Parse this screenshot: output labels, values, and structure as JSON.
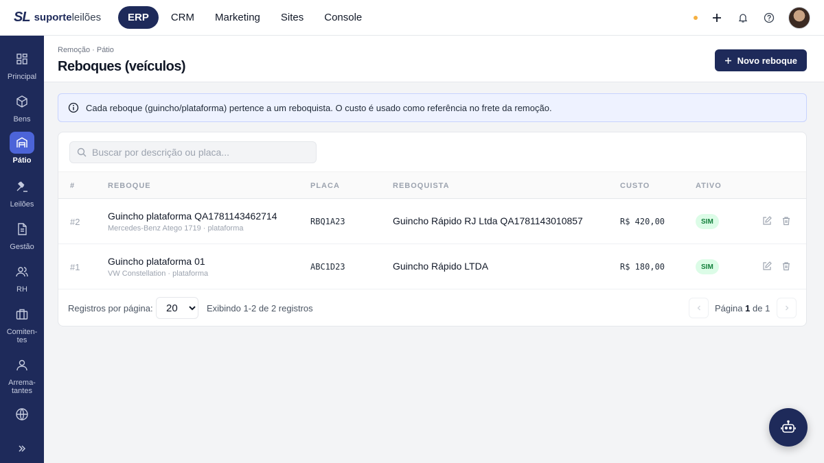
{
  "app": {
    "logo_mark": "SL",
    "logo_bold": "suporte",
    "logo_light": "leilões"
  },
  "topnav": {
    "items": [
      "ERP",
      "CRM",
      "Marketing",
      "Sites",
      "Console"
    ],
    "active": "ERP",
    "status_color": "#f5b041"
  },
  "sidebar": {
    "items": [
      {
        "label": "Principal",
        "icon": "dashboard-icon"
      },
      {
        "label": "Bens",
        "icon": "box-icon"
      },
      {
        "label": "Pátio",
        "icon": "warehouse-icon",
        "active": true
      },
      {
        "label": "Leilões",
        "icon": "gavel-icon"
      },
      {
        "label": "Gestão",
        "icon": "document-icon"
      },
      {
        "label": "RH",
        "icon": "people-icon"
      },
      {
        "label": "Comiten-\ntes",
        "icon": "briefcase-icon"
      },
      {
        "label": "Arrema-\ntantes",
        "icon": "user-icon"
      },
      {
        "label": "",
        "icon": "globe-icon"
      }
    ],
    "collapse_icon": "double-chevron-right-icon",
    "accent": "#4c64d8"
  },
  "header": {
    "breadcrumb": "Remoção · Pátio",
    "title": "Reboques (veículos)",
    "new_button": "Novo reboque"
  },
  "info": {
    "text": "Cada reboque (guincho/plataforma) pertence a um reboquista. O custo é usado como referência no frete da remoção."
  },
  "search": {
    "placeholder": "Buscar por descrição ou placa...",
    "value": ""
  },
  "table": {
    "headers": {
      "id": "#",
      "reboque": "REBOQUE",
      "placa": "PLACA",
      "reboquista": "REBOQUISTA",
      "custo": "CUSTO",
      "ativo": "ATIVO"
    },
    "rows": [
      {
        "id": "#2",
        "name": "Guincho plataforma QA1781143462714",
        "sub": "Mercedes-Benz Atego 1719 · plataforma",
        "plate": "RBQ1A23",
        "towing": "Guincho Rápido RJ Ltda QA1781143010857",
        "cost": "R$ 420,00",
        "active": "SIM"
      },
      {
        "id": "#1",
        "name": "Guincho plataforma 01",
        "sub": "VW Constellation · plataforma",
        "plate": "ABC1D23",
        "towing": "Guincho Rápido LTDA",
        "cost": "R$ 180,00",
        "active": "SIM"
      }
    ]
  },
  "pager": {
    "per_page_label": "Registros por página:",
    "per_page": "20",
    "info": "Exibindo 1-2 de 2 registros",
    "page_prefix": "Página",
    "page": "1",
    "page_sep": "de",
    "total_pages": "1"
  },
  "colors": {
    "brand": "#1e2a5a",
    "badge_bg": "#dcfce7",
    "badge_fg": "#15803d"
  }
}
